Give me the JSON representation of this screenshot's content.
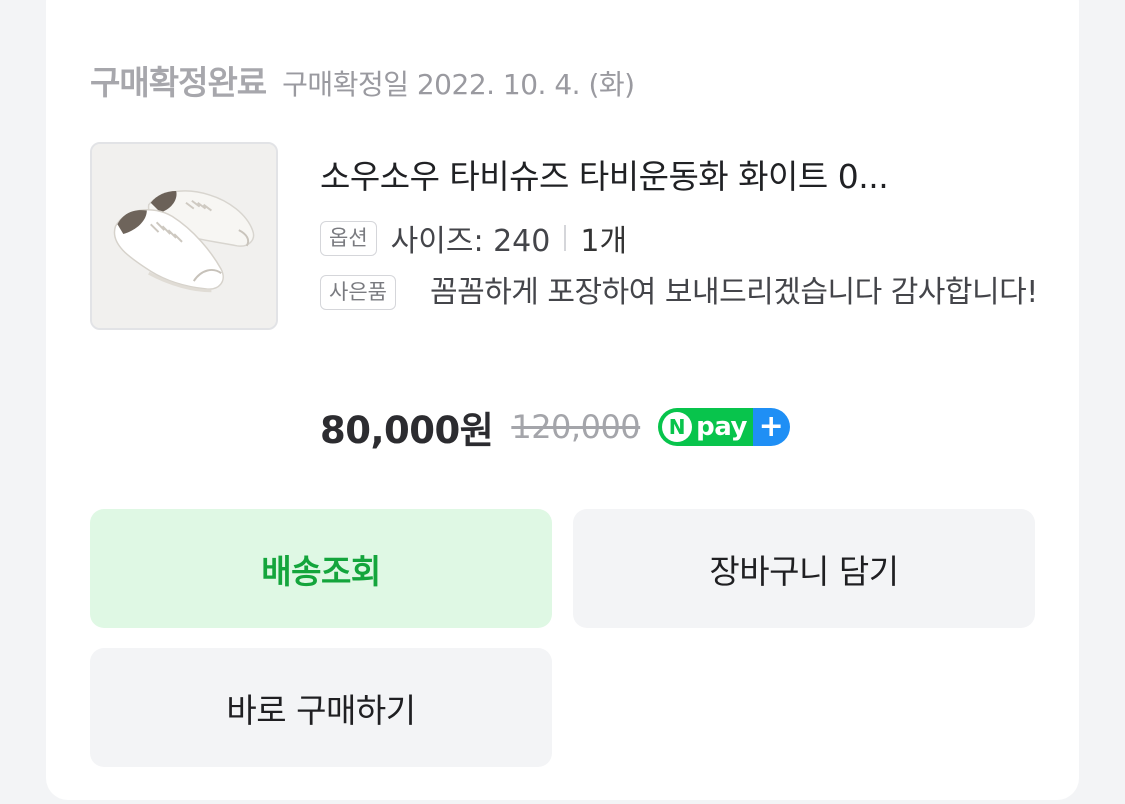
{
  "order": {
    "status_title": "구매확정완료",
    "status_date": "구매확정일 2022. 10. 4. (화)"
  },
  "product": {
    "name": "소우소우 타비슈즈 타비운동화 화이트 0...",
    "option_tag": "옵션",
    "option_value": "사이즈: 240",
    "quantity": "1개",
    "gift_tag": "사은품",
    "gift_text": "꼼꼼하게 포장하여 보내드리겠습니다 감사합니다!",
    "price": "80,000원",
    "original_price": "120,000",
    "npay_badge": {
      "n_letter": "N",
      "word": "pay",
      "plus": "+",
      "green": "#08c44c",
      "blue": "#1f8ff5"
    }
  },
  "actions": {
    "track_delivery": "배송조회",
    "add_to_cart": "장바구니 담기",
    "buy_now": "바로 구매하기"
  },
  "colors": {
    "accent_green": "#14a53c",
    "accent_green_bg": "#dff8e4",
    "button_bg": "#f3f4f6"
  },
  "icons": {
    "product_thumbnail": "white-tabi-sneakers-image",
    "npay_badge": "naver-pay-plus-logo"
  }
}
